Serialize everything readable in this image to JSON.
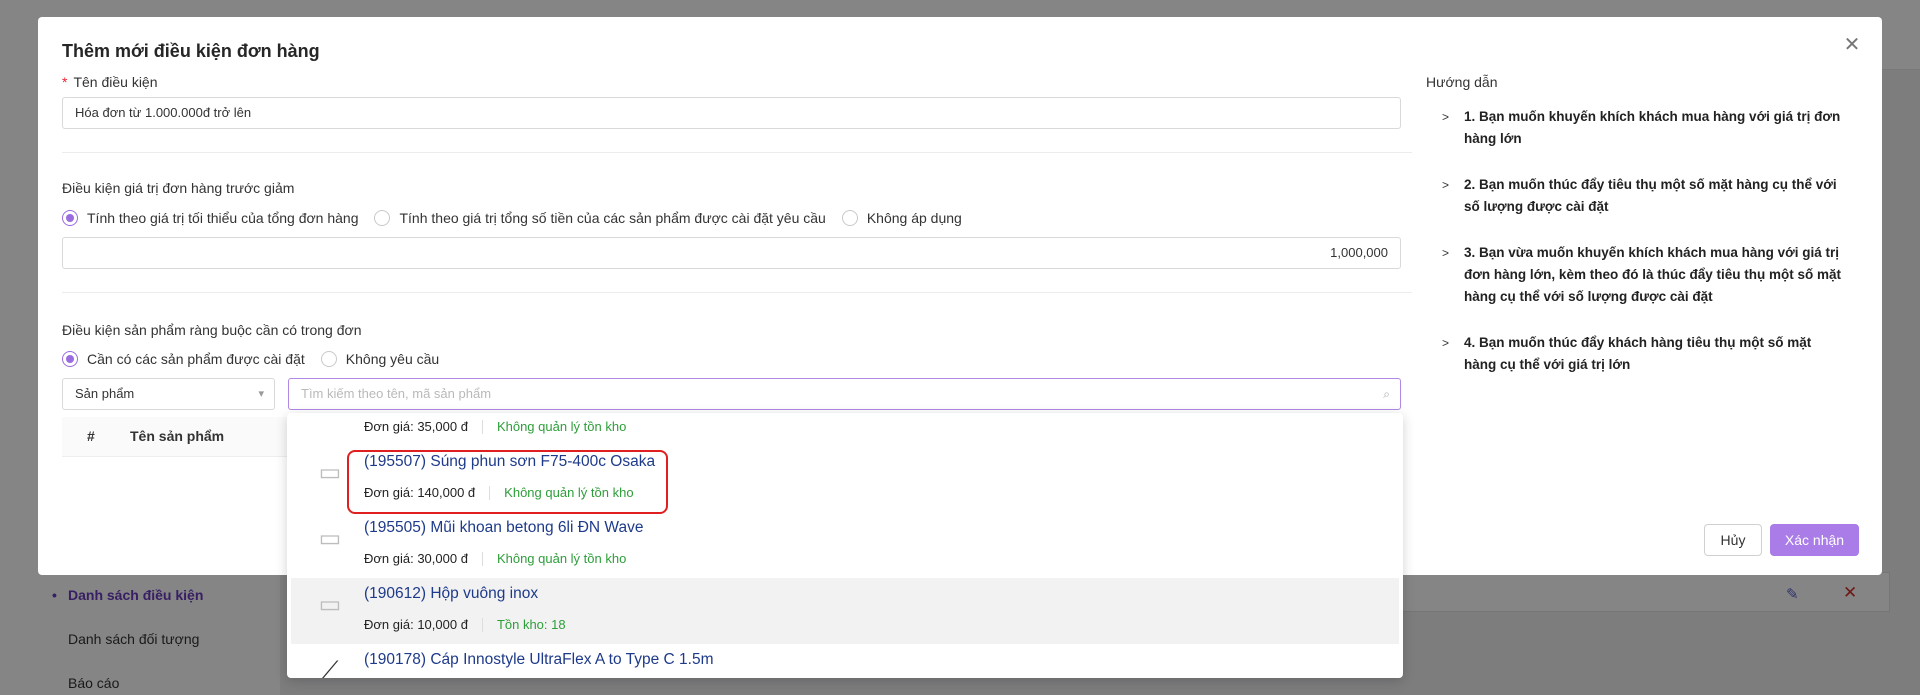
{
  "background": {
    "sidebar_items": [
      {
        "label": "Danh sách điều kiện",
        "active": true
      },
      {
        "label": "Danh sách đối tượng",
        "active": false
      },
      {
        "label": "Báo cáo",
        "active": false
      }
    ]
  },
  "modal": {
    "title": "Thêm mới điều kiện đơn hàng",
    "name_label": "Tên điều kiện",
    "name_value": "Hóa đơn từ 1.000.000đ trở lên",
    "order_value_section": {
      "label": "Điều kiện giá trị đơn hàng trước giảm",
      "options": [
        {
          "label": "Tính theo giá trị tối thiểu của tổng đơn hàng",
          "checked": true
        },
        {
          "label": "Tính theo giá trị tổng số tiền của các sản phẩm được cài đặt yêu cầu",
          "checked": false
        },
        {
          "label": "Không áp dụng",
          "checked": false
        }
      ],
      "amount": "1,000,000"
    },
    "product_section": {
      "label": "Điều kiện sản phẩm ràng buộc cần có trong đơn",
      "options": [
        {
          "label": "Cần có các sản phẩm được cài đặt",
          "checked": true
        },
        {
          "label": "Không yêu cầu",
          "checked": false
        }
      ],
      "type_select": "Sản phẩm",
      "search_placeholder": "Tìm kiếm theo tên, mã sản phẩm",
      "table_headers": {
        "index": "#",
        "name": "Tên sản phẩm"
      }
    },
    "guide": {
      "title": "Hướng dẫn",
      "items": [
        "1. Bạn muốn khuyến khích khách mua hàng với giá trị đơn hàng lớn",
        "2. Bạn muốn thúc đẩy tiêu thụ một số mặt hàng cụ thể với số lượng được cài đặt",
        "3. Bạn vừa muốn khuyến khích khách mua hàng với giá trị đơn hàng lớn, kèm theo đó là thúc đẩy tiêu thụ một số mặt hàng cụ thể với số lượng được cài đặt",
        "4. Bạn muốn thúc đẩy khách hàng tiêu thụ một số mặt hàng cụ thể với giá trị lớn"
      ]
    },
    "buttons": {
      "cancel": "Hủy",
      "confirm": "Xác nhận"
    }
  },
  "dropdown": {
    "partial_top": {
      "price": "Đơn giá: 35,000 đ",
      "stock": "Không quản lý tồn kho"
    },
    "items": [
      {
        "name": "(195507) Súng phun sơn F75-400c Osaka",
        "price": "Đơn giá: 140,000 đ",
        "stock": "Không quản lý tồn kho",
        "highlighted": true
      },
      {
        "name": "(195505) Mũi khoan betong 6li ĐN Wave",
        "price": "Đơn giá: 30,000 đ",
        "stock": "Không quản lý tồn kho"
      },
      {
        "name": "(190612) Hộp vuông inox",
        "price": "Đơn giá: 10,000 đ",
        "stock": "Tồn kho: 18",
        "hover": true
      }
    ],
    "partial_bottom": {
      "name": "(190178) Cáp Innostyle UltraFlex A to Type C 1.5m"
    }
  },
  "colors": {
    "accent": "#a97ce8",
    "link": "#1e3a8a",
    "stock_green": "#2e9e3a",
    "highlight_red": "#e02020"
  }
}
